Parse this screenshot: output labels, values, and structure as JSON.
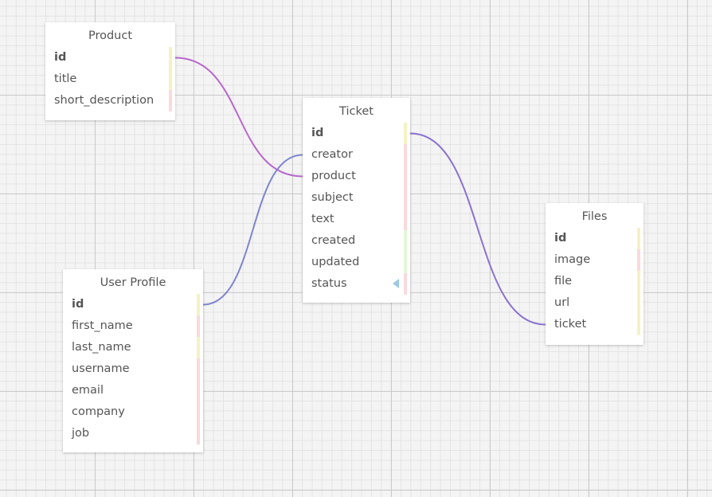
{
  "colors": {
    "pk_bar": "#f4f2c3",
    "text_bar": "#fad9dc",
    "date_bar": "#e2f7d8",
    "fk_bar": "#f4f2c3",
    "link_product": "#b768cd",
    "link_creator": "#7f86cf",
    "link_files": "#8a72d0"
  },
  "tables": [
    {
      "name": "Product",
      "fields": [
        {
          "name": "id",
          "pk": true,
          "bar": "pk_bar"
        },
        {
          "name": "title",
          "pk": false,
          "bar": "pk_bar"
        },
        {
          "name": "short_description",
          "pk": false,
          "bar": "text_bar"
        }
      ]
    },
    {
      "name": "Ticket",
      "fields": [
        {
          "name": "id",
          "pk": true,
          "bar": "pk_bar"
        },
        {
          "name": "creator",
          "pk": false,
          "bar": "text_bar"
        },
        {
          "name": "product",
          "pk": false,
          "bar": "text_bar"
        },
        {
          "name": "subject",
          "pk": false,
          "bar": "text_bar"
        },
        {
          "name": "text",
          "pk": false,
          "bar": "text_bar"
        },
        {
          "name": "created",
          "pk": false,
          "bar": "date_bar"
        },
        {
          "name": "updated",
          "pk": false,
          "bar": "date_bar"
        },
        {
          "name": "status",
          "pk": false,
          "bar": "text_bar",
          "marker": "enum-arrow-icon"
        }
      ]
    },
    {
      "name": "User Profile",
      "fields": [
        {
          "name": "id",
          "pk": true,
          "bar": "pk_bar"
        },
        {
          "name": "first_name",
          "pk": false,
          "bar": "text_bar"
        },
        {
          "name": "last_name",
          "pk": false,
          "bar": "pk_bar"
        },
        {
          "name": "username",
          "pk": false,
          "bar": "text_bar"
        },
        {
          "name": "email",
          "pk": false,
          "bar": "text_bar"
        },
        {
          "name": "company",
          "pk": false,
          "bar": "text_bar"
        },
        {
          "name": "job",
          "pk": false,
          "bar": "text_bar"
        }
      ]
    },
    {
      "name": "Files",
      "fields": [
        {
          "name": "id",
          "pk": true,
          "bar": "pk_bar"
        },
        {
          "name": "image",
          "pk": false,
          "bar": "text_bar"
        },
        {
          "name": "file",
          "pk": false,
          "bar": "pk_bar"
        },
        {
          "name": "url",
          "pk": false,
          "bar": "pk_bar"
        },
        {
          "name": "ticket",
          "pk": false,
          "bar": "pk_bar"
        }
      ]
    }
  ],
  "relations": [
    {
      "from": "Product.id",
      "to": "Ticket.product",
      "color": "link_product"
    },
    {
      "from": "User Profile.id",
      "to": "Ticket.creator",
      "color": "link_creator"
    },
    {
      "from": "Ticket.id",
      "to": "Files.ticket",
      "color": "link_files"
    }
  ]
}
